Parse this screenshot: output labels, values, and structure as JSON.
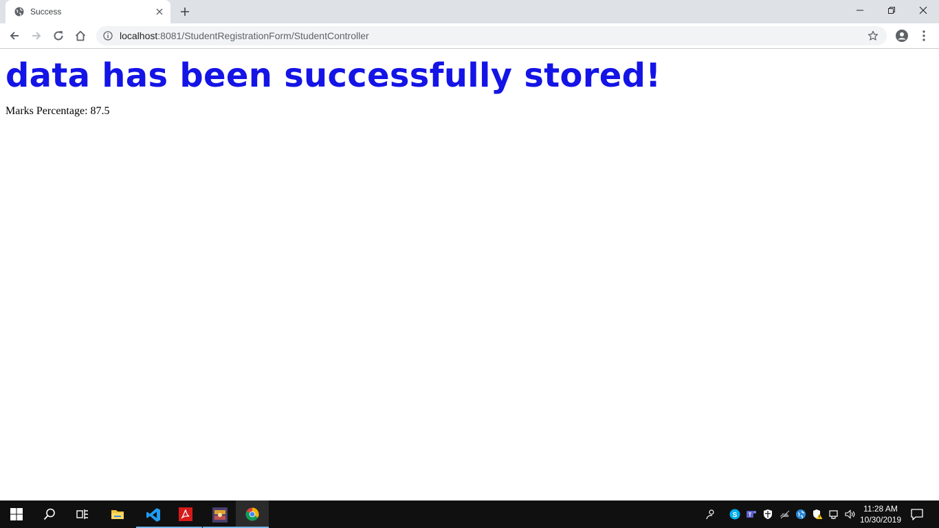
{
  "browser": {
    "tab": {
      "title": "Success",
      "favicon": "globe-icon"
    },
    "address_bar": {
      "host": "localhost",
      "rest": ":8081/StudentRegistrationForm/StudentController"
    }
  },
  "page": {
    "heading": "data has been successfully stored!",
    "marks_text": "Marks Percentage: 87.5",
    "heading_color": "#0000ee"
  },
  "taskbar": {
    "apps": [
      "windows-start-icon",
      "search-icon",
      "task-view-icon",
      "file-explorer-icon",
      "vs-code-icon",
      "acrobat-icon",
      "game-ide-icon",
      "chrome-icon"
    ],
    "clock": {
      "time": "11:28 AM",
      "date": "10/30/2019"
    }
  }
}
